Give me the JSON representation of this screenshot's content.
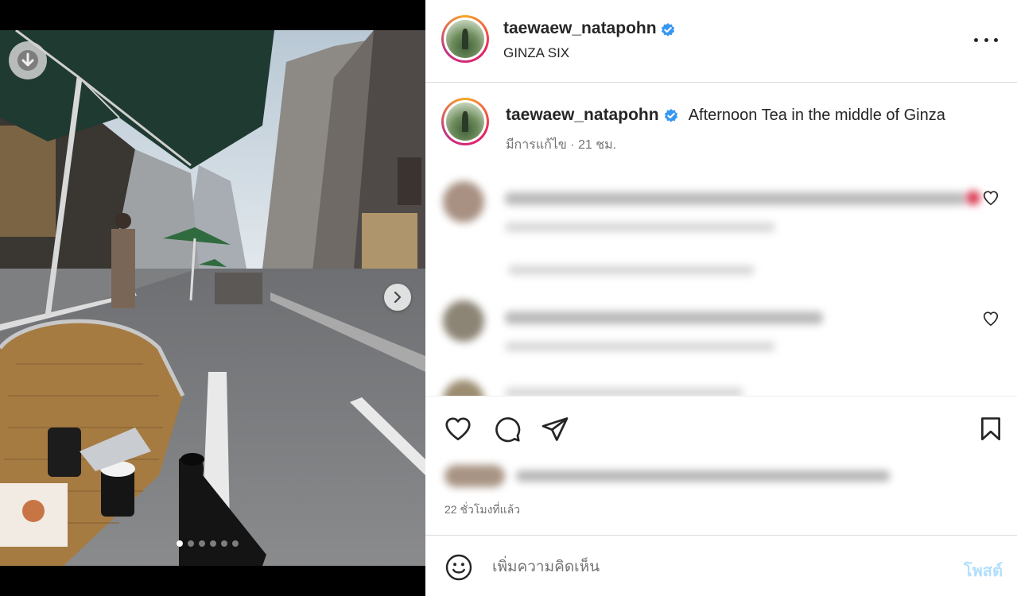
{
  "post": {
    "username": "taewaew_natapohn",
    "location": "GINZA SIX",
    "verified": true,
    "caption": "Afternoon Tea in the middle of Ginza",
    "caption_meta": "มีการแก้ไข · 21 ชม.",
    "time_ago": "22 ชั่วโมงที่แล้ว",
    "comment_placeholder": "เพิ่มความคิดเห็น",
    "post_button": "โพสต์"
  },
  "media": {
    "image_index": 1,
    "image_count": 6,
    "icons": {
      "download": "download-arrow-icon",
      "next": "chevron-right-icon"
    }
  },
  "icons": {
    "verified": "verified-badge-icon",
    "more": "more-options-icon",
    "like": "heart-icon",
    "comment": "comment-bubble-icon",
    "share": "paper-plane-icon",
    "save": "bookmark-icon",
    "emoji": "emoji-smile-icon"
  },
  "colors": {
    "verified_blue": "#3897f0",
    "post_button_disabled": "#b2dffc",
    "avatar_ring_start": "#f9a825",
    "avatar_ring_end": "#c13584",
    "text_primary": "#262626",
    "text_secondary": "#737373"
  }
}
